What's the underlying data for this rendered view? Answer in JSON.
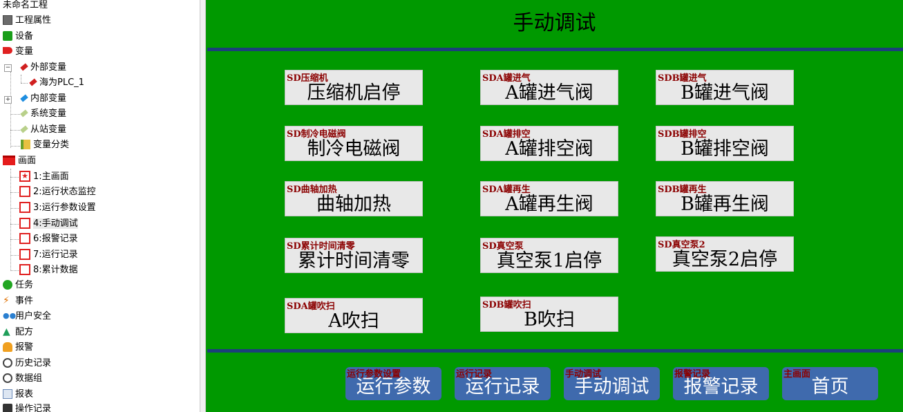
{
  "sidebar": {
    "project": "未命名工程",
    "items": {
      "project_props": "工程属性",
      "device": "设备",
      "variables": "变量",
      "external_vars": "外部变量",
      "plc": "海为PLC_1",
      "internal_vars": "内部变量",
      "system_vars": "系统变量",
      "slave_vars": "从站变量",
      "var_category": "变量分类",
      "screens": "画面",
      "screen1": "1:主画面",
      "screen2": "2:运行状态监控",
      "screen3": "3:运行参数设置",
      "screen4": "4:手动调试",
      "screen6": "6:报警记录",
      "screen7": "7:运行记录",
      "screen8": "8:累计数据",
      "tasks": "任务",
      "events": "事件",
      "user_security": "用户安全",
      "recipe": "配方",
      "alarm": "报警",
      "history": "历史记录",
      "data_group": "数据组",
      "report": "报表",
      "op_log": "操作记录"
    }
  },
  "screen": {
    "title": "手动调试",
    "buttons": [
      {
        "label": "压缩机启停",
        "tag": "SD压缩机"
      },
      {
        "label": "A罐进气阀",
        "tag": "SDA罐进气"
      },
      {
        "label": "B罐进气阀",
        "tag": "SDB罐进气"
      },
      {
        "label": "制冷电磁阀",
        "tag": "SD制冷电磁阀"
      },
      {
        "label": "A罐排空阀",
        "tag": "SDA罐排空"
      },
      {
        "label": "B罐排空阀",
        "tag": "SDB罐排空"
      },
      {
        "label": "曲轴加热",
        "tag": "SD曲轴加热"
      },
      {
        "label": "A罐再生阀",
        "tag": "SDA罐再生"
      },
      {
        "label": "B罐再生阀",
        "tag": "SDB罐再生"
      },
      {
        "label": "累计时间清零",
        "tag": "SD累计时间清零"
      },
      {
        "label": "真空泵1启停",
        "tag": "SD真空泵"
      },
      {
        "label": "真空泵2启停",
        "tag": "SD真空泵2"
      },
      {
        "label": "A吹扫",
        "tag": "SDA罐吹扫"
      },
      {
        "label": "B吹扫",
        "tag": "SDB罐吹扫"
      }
    ],
    "nav": [
      {
        "label": "运行参数",
        "tag": "运行参数设置"
      },
      {
        "label": "运行记录",
        "tag": "运行记录"
      },
      {
        "label": "手动调试",
        "tag": "手动调试"
      },
      {
        "label": "报警记录",
        "tag": "报警记录"
      },
      {
        "label": "首页",
        "tag": "主画面"
      }
    ]
  },
  "colors": {
    "screen_bg": "#009900",
    "separator": "#1b3f7a",
    "button_bg": "#e8e8e8",
    "nav_bg": "#3f6aad",
    "tag_text": "#8b0000"
  }
}
